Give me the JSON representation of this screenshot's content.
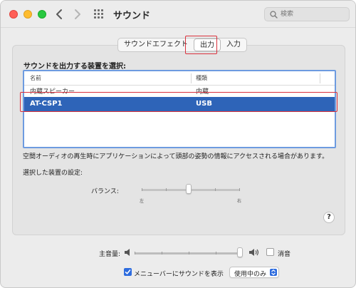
{
  "window": {
    "title": "サウンド"
  },
  "search": {
    "placeholder": "検索"
  },
  "tabs": [
    {
      "label": "サウンドエフェクト"
    },
    {
      "label": "出力"
    },
    {
      "label": "入力"
    }
  ],
  "active_tab": "出力",
  "output": {
    "heading": "サウンドを出力する装置を選択:",
    "columns": {
      "name": "名前",
      "type": "種類"
    },
    "devices": [
      {
        "name": "内蔵スピーカー",
        "type": "内蔵"
      },
      {
        "name": "AT-CSP1",
        "type": "USB"
      }
    ],
    "selected_device": "AT-CSP1",
    "spatial_audio_notice": "空間オーディオの再生時にアプリケーションによって頭部の姿勢の情報にアクセスされる場合があります。",
    "settings_label": "選択した装置の設定:",
    "balance": {
      "label": "バランス:",
      "left": "左",
      "right": "右",
      "value": 0.5
    }
  },
  "volume": {
    "label": "主音量:",
    "level": 1.0,
    "mute_label": "消音",
    "muted": false
  },
  "menubar": {
    "label": "メニューバーにサウンドを表示",
    "checked": true,
    "option": "使用中のみ"
  },
  "help": {
    "label": "?"
  },
  "colors": {
    "selection": "#2e64b8",
    "highlight_box": "#d9303c",
    "accent": "#2e6cde"
  }
}
